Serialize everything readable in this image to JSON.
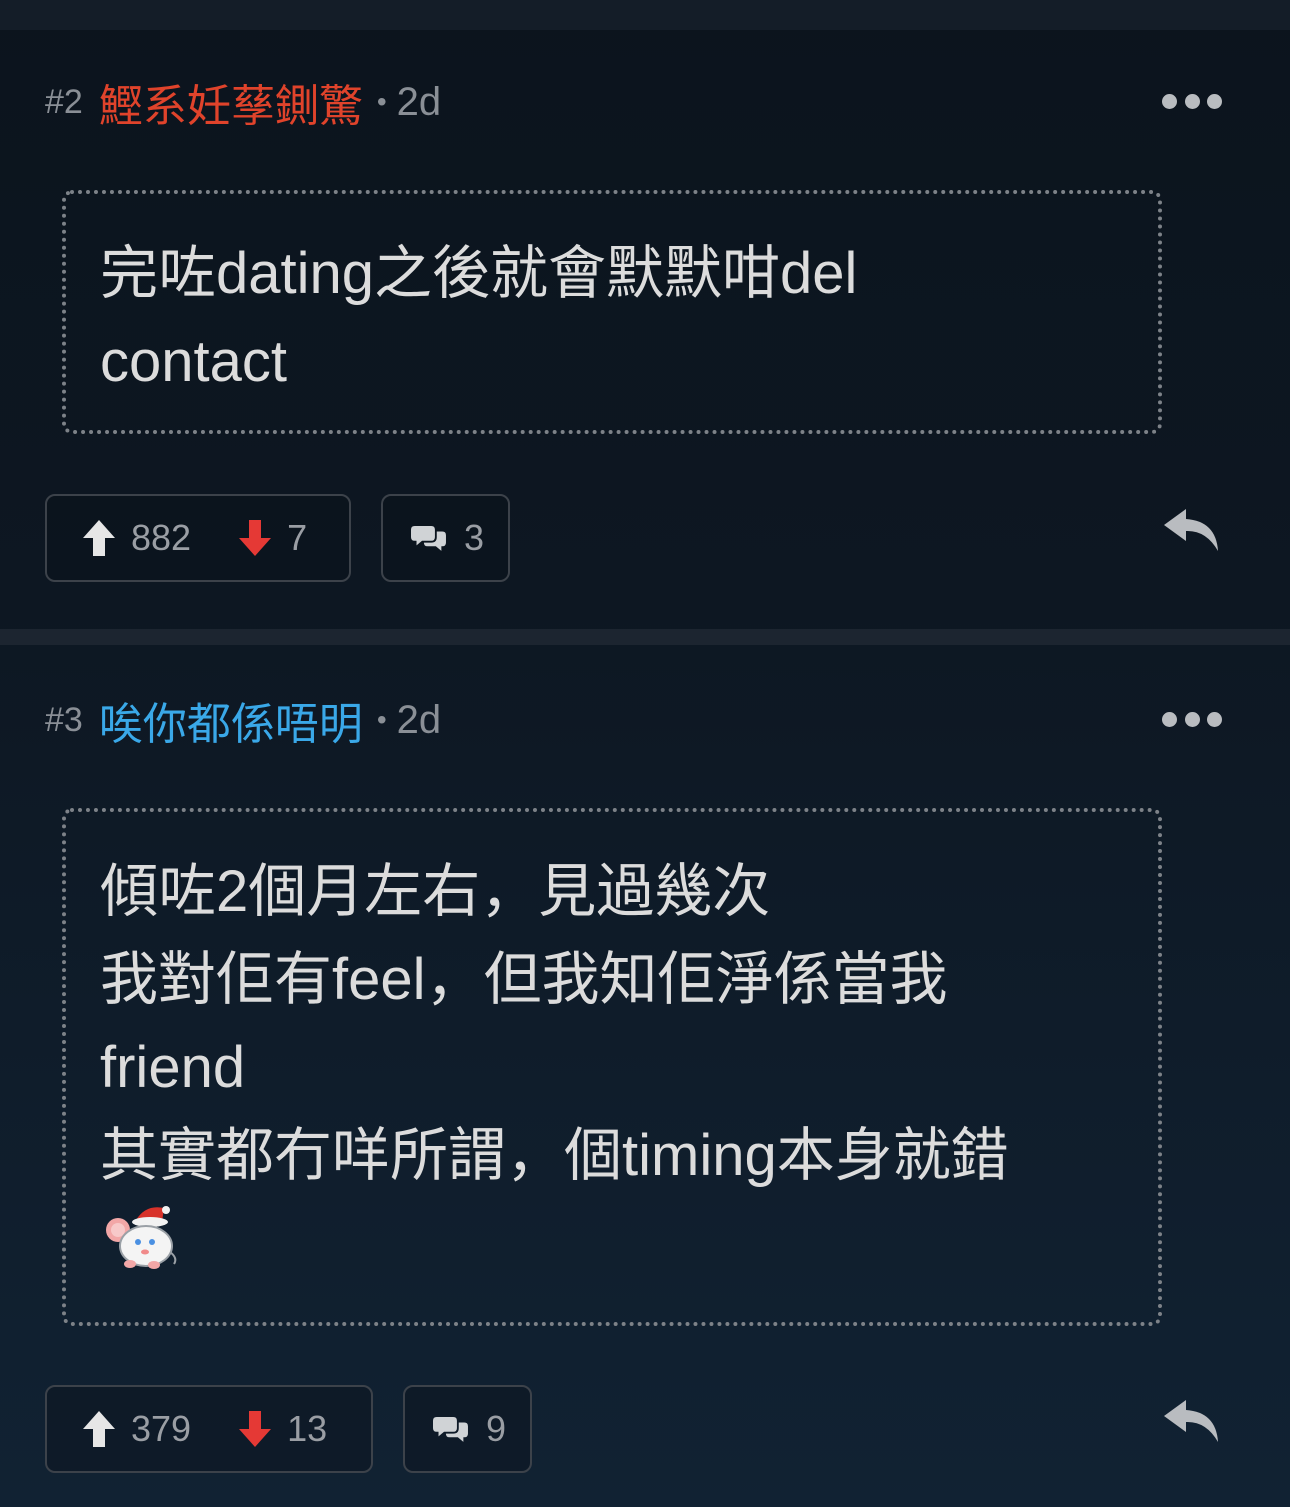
{
  "posts": [
    {
      "floor": "#2",
      "author": "鰹系妊孶鍘驚",
      "author_color": "#e0432b",
      "separator": "•",
      "time": "2d",
      "content_lines": [
        "完咗dating之後就會默默咁del",
        "contact"
      ],
      "upvotes": "882",
      "downvotes": "7",
      "comments": "3",
      "icons": {
        "more": "more-options-icon",
        "upvote": "arrow-up-icon",
        "downvote": "arrow-down-icon",
        "comment": "comment-bubble-icon",
        "reply": "reply-arrow-icon"
      }
    },
    {
      "floor": "#3",
      "author": "唉你都係唔明",
      "author_color": "#3aa8e8",
      "separator": "•",
      "time": "2d",
      "content_lines": [
        "傾咗2個月左右，見過幾次",
        "我對佢有feel，但我知佢淨係當我",
        "friend",
        "其實都冇咩所謂，個timing本身就錯"
      ],
      "sticker": "santa-mouse-sticker",
      "upvotes": "379",
      "downvotes": "13",
      "comments": "9",
      "icons": {
        "more": "more-options-icon",
        "upvote": "arrow-up-icon",
        "downvote": "arrow-down-icon",
        "comment": "comment-bubble-icon",
        "reply": "reply-arrow-icon"
      }
    }
  ],
  "colors": {
    "upvote": "#e6e6e6",
    "downvote": "#e53935",
    "background": "#0d1722"
  }
}
